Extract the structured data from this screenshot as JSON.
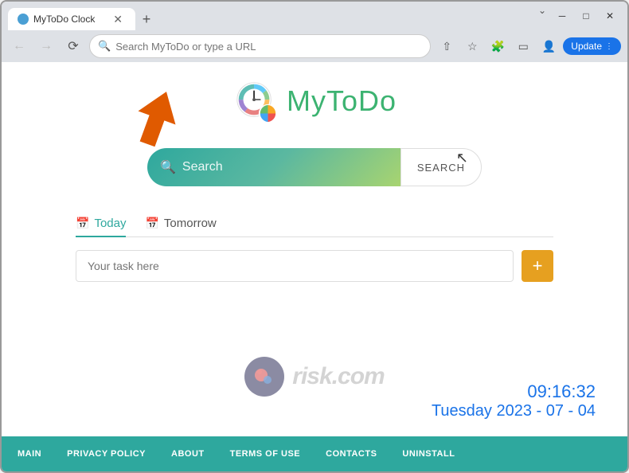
{
  "browser": {
    "tab_title": "MyToDo Clock",
    "address_placeholder": "Search MyToDo or type a URL",
    "update_label": "Update",
    "new_tab_label": "+",
    "window_controls": {
      "minimize": "─",
      "maximize": "□",
      "close": "✕",
      "chevron": "⌄"
    }
  },
  "logo": {
    "app_name": "MyToDo"
  },
  "search": {
    "placeholder": "Search",
    "button_label": "SEARCH"
  },
  "tabs": [
    {
      "id": "today",
      "label": "Today",
      "active": true
    },
    {
      "id": "tomorrow",
      "label": "Tomorrow",
      "active": false
    }
  ],
  "task": {
    "placeholder": "Your task here",
    "add_btn": "+"
  },
  "clock": {
    "time": "09:16:32",
    "date": "Tuesday 2023 - 07 - 04"
  },
  "footer": {
    "items": [
      {
        "id": "main",
        "label": "MAIN"
      },
      {
        "id": "privacy",
        "label": "PRIVACY POLICY"
      },
      {
        "id": "about",
        "label": "ABOUT"
      },
      {
        "id": "terms",
        "label": "TERMS OF USE"
      },
      {
        "id": "contacts",
        "label": "CONTACTS"
      },
      {
        "id": "uninstall",
        "label": "UNINSTALL"
      }
    ]
  }
}
